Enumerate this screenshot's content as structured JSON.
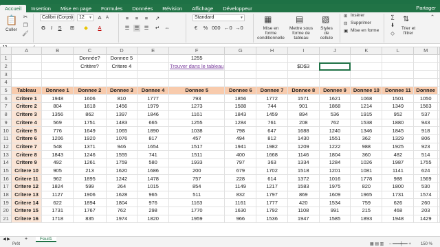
{
  "tabs": [
    "Accueil",
    "Insertion",
    "Mise en page",
    "Formules",
    "Données",
    "Révision",
    "Affichage",
    "Développeur"
  ],
  "share_label": "Partager",
  "ribbon": {
    "paste_label": "Coller",
    "font_name": "Calibri (Corps)",
    "font_size": "12",
    "number_format": "Standard",
    "cond_format": "Mise en forme conditionnelle",
    "table_format": "Mettre sous forme de tableau",
    "cell_styles": "Styles de cellule",
    "insert": "Insérer",
    "delete": "Supprimer",
    "format": "Mise en forme",
    "sort_filter": "Trier et filtrer",
    "sum_icon": "∑",
    "fill_icon": "⬇",
    "clear_icon": "◇"
  },
  "name_box": "J2",
  "fx_label": "fx",
  "formula_value": "",
  "columns": [
    "A",
    "B",
    "C",
    "D",
    "E",
    "F",
    "G",
    "H",
    "I",
    "J",
    "K",
    "L",
    "M"
  ],
  "top_rows": [
    {
      "num": "1",
      "cells": [
        "",
        "",
        "Donnée?",
        "Donnee 5",
        "",
        "1255",
        "",
        "",
        "",
        "",
        "",
        "",
        ""
      ]
    },
    {
      "num": "2",
      "cells": [
        "",
        "",
        "Critère?",
        "Critere 4",
        "",
        "Trouver dans le tableau",
        "",
        "",
        "$D$3",
        "",
        "",
        "",
        ""
      ]
    },
    {
      "num": "3",
      "cells": [
        "",
        "",
        "",
        "",
        "",
        "",
        "",
        "",
        "",
        "",
        "",
        "",
        ""
      ]
    },
    {
      "num": "4",
      "cells": [
        "",
        "",
        "",
        "",
        "",
        "",
        "",
        "",
        "",
        "",
        "",
        "",
        ""
      ]
    }
  ],
  "header_row": {
    "num": "5",
    "cells": [
      "Tableau",
      "Donnee 1",
      "Donnee 2",
      "Donnee 3",
      "Donnee 4",
      "Donnee 5",
      "Donnee 6",
      "Donnee 7",
      "Donnee 8",
      "Donnee 9",
      "Donnee 10",
      "Donnee 11",
      "Donnee"
    ]
  },
  "data_rows": [
    {
      "num": "6",
      "cells": [
        "Critere 1",
        "1948",
        "1606",
        "810",
        "1777",
        "793",
        "1856",
        "1772",
        "1571",
        "1621",
        "1068",
        "1501",
        "1050"
      ]
    },
    {
      "num": "7",
      "cells": [
        "Critere 2",
        "804",
        "1618",
        "1456",
        "1979",
        "1273",
        "1588",
        "744",
        "901",
        "1868",
        "1214",
        "1349",
        "1563"
      ]
    },
    {
      "num": "8",
      "cells": [
        "Critere 3",
        "1356",
        "862",
        "1397",
        "1846",
        "1161",
        "1843",
        "1459",
        "894",
        "536",
        "1915",
        "952",
        "537"
      ]
    },
    {
      "num": "9",
      "cells": [
        "Critere 4",
        "569",
        "1751",
        "1483",
        "665",
        "1255",
        "1284",
        "761",
        "208",
        "762",
        "1538",
        "1880",
        "943"
      ]
    },
    {
      "num": "10",
      "cells": [
        "Critere 5",
        "776",
        "1649",
        "1065",
        "1890",
        "1038",
        "798",
        "647",
        "1688",
        "1240",
        "1346",
        "1845",
        "918"
      ]
    },
    {
      "num": "11",
      "cells": [
        "Critere 6",
        "1206",
        "1920",
        "1076",
        "817",
        "457",
        "494",
        "812",
        "1430",
        "1551",
        "362",
        "1329",
        "806"
      ]
    },
    {
      "num": "12",
      "cells": [
        "Critere 7",
        "548",
        "1371",
        "946",
        "1654",
        "1517",
        "1941",
        "1982",
        "1209",
        "1222",
        "988",
        "1925",
        "923"
      ]
    },
    {
      "num": "13",
      "cells": [
        "Critere 8",
        "1843",
        "1246",
        "1555",
        "741",
        "1511",
        "400",
        "1668",
        "1146",
        "1804",
        "360",
        "482",
        "514"
      ]
    },
    {
      "num": "14",
      "cells": [
        "Critere 9",
        "492",
        "1261",
        "1759",
        "580",
        "1933",
        "797",
        "363",
        "1334",
        "1284",
        "1026",
        "1987",
        "1755"
      ]
    },
    {
      "num": "15",
      "cells": [
        "Critere 10",
        "905",
        "213",
        "1620",
        "1686",
        "200",
        "679",
        "1702",
        "1518",
        "1201",
        "1081",
        "1141",
        "624"
      ]
    },
    {
      "num": "16",
      "cells": [
        "Critere 11",
        "962",
        "1895",
        "1242",
        "1478",
        "757",
        "228",
        "614",
        "1372",
        "1016",
        "1778",
        "988",
        "1569"
      ]
    },
    {
      "num": "17",
      "cells": [
        "Critere 12",
        "1824",
        "599",
        "264",
        "1015",
        "854",
        "1149",
        "1217",
        "1583",
        "1975",
        "820",
        "1800",
        "530"
      ]
    },
    {
      "num": "18",
      "cells": [
        "Critere 13",
        "1127",
        "1906",
        "1628",
        "965",
        "511",
        "832",
        "1797",
        "869",
        "1609",
        "1965",
        "1731",
        "1574"
      ]
    },
    {
      "num": "19",
      "cells": [
        "Critere 14",
        "622",
        "1894",
        "1804",
        "976",
        "1163",
        "1161",
        "1777",
        "420",
        "1534",
        "759",
        "626",
        "260"
      ]
    },
    {
      "num": "20",
      "cells": [
        "Critere 15",
        "1731",
        "1767",
        "762",
        "298",
        "1770",
        "1630",
        "1792",
        "1108",
        "991",
        "215",
        "468",
        "203"
      ]
    },
    {
      "num": "21",
      "cells": [
        "Critere 16",
        "1718",
        "835",
        "1974",
        "1820",
        "1959",
        "966",
        "1536",
        "1947",
        "1585",
        "1893",
        "1948",
        "1429"
      ]
    }
  ],
  "sheet_tab": "Feuil1",
  "status": {
    "ready": "Prêt",
    "zoom": "150 %"
  },
  "colors": {
    "accent": "#217346",
    "header_fill": "#f8cbad",
    "criteria_fill": "#fbe5d6",
    "link": "#7b3f9e"
  }
}
